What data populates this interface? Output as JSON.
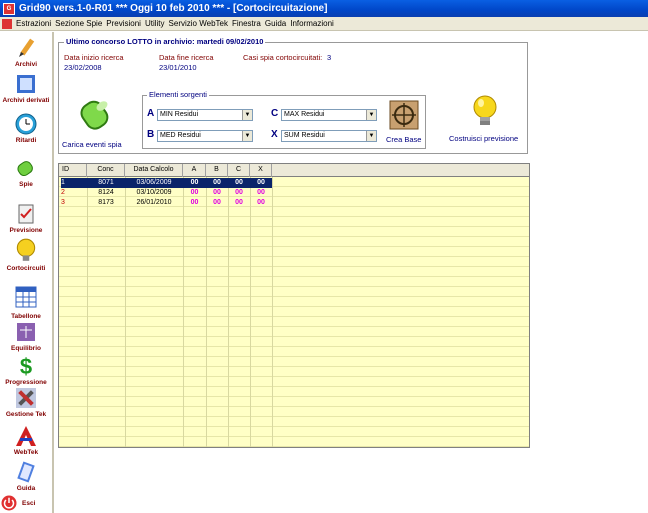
{
  "window": {
    "title": "Grid90 vers.1-0-R01  ***  Oggi 10 feb 2010  ***   - [Cortocircuitazione]"
  },
  "menu": [
    "Estrazioni",
    "Sezione Spie",
    "Previsioni",
    "Utility",
    "Servizio WebTek",
    "Finestra",
    "Guida",
    "Informazioni"
  ],
  "sidebar": [
    {
      "label": "Archivi",
      "icon": "pencil-icon"
    },
    {
      "label": "Archivi derivati",
      "icon": "notebook-icon"
    },
    {
      "label": "Ritardi",
      "icon": "clock-icon"
    },
    {
      "label": "Spie",
      "icon": "lamp-icon"
    },
    {
      "label": "Previsione",
      "icon": "clipboard-icon"
    },
    {
      "label": "Cortocircuiti",
      "icon": "bulb-icon"
    },
    {
      "label": "Tabellone",
      "icon": "calendar-icon"
    },
    {
      "label": "Equilibrio",
      "icon": "scale-icon"
    },
    {
      "label": "Progressione",
      "icon": "dollar-icon"
    },
    {
      "label": "Gestione Tek",
      "icon": "tools-icon"
    },
    {
      "label": "WebTek",
      "icon": "webtek-logo-icon"
    },
    {
      "label": "Guida",
      "icon": "guide-icon"
    },
    {
      "label": "Esci",
      "icon": "exit-icon"
    }
  ],
  "header": {
    "legend": "Ultimo concorso LOTTO in archivio: martedi 09/02/2010",
    "data_inizio_label": "Data inizio ricerca",
    "data_inizio_value": "23/02/2008",
    "data_fine_label": "Data fine ricerca",
    "data_fine_value": "23/01/2010",
    "casi_label": "Casi spia cortocircuitati:",
    "casi_value": "3"
  },
  "actions": {
    "carica": "Carica eventi spia",
    "crea": "Crea Base",
    "costruisci": "Costruisci previsione"
  },
  "elementi": {
    "legend": "Elementi sorgenti",
    "A": {
      "letter": "A",
      "value": "MIN Residui"
    },
    "B": {
      "letter": "B",
      "value": "MED Residui"
    },
    "C": {
      "letter": "C",
      "value": "MAX Residui"
    },
    "X": {
      "letter": "X",
      "value": "SUM Residui"
    }
  },
  "grid": {
    "columns": [
      "ID",
      "Conc",
      "Data Calcolo",
      "A",
      "B",
      "C",
      "X"
    ],
    "rows": [
      {
        "id": "1",
        "conc": "8071",
        "data": "03/06/2009",
        "a": "00",
        "b": "00",
        "c": "00",
        "x": "00",
        "selected": true
      },
      {
        "id": "2",
        "conc": "8124",
        "data": "03/10/2009",
        "a": "00",
        "b": "00",
        "c": "00",
        "x": "00",
        "selected": false
      },
      {
        "id": "3",
        "conc": "8173",
        "data": "26/01/2010",
        "a": "00",
        "b": "00",
        "c": "00",
        "x": "00",
        "selected": false
      }
    ]
  },
  "colors": {
    "title_blue": "#0046c8",
    "grid_bg": "#ffffc6",
    "selected_row": "#0a246a",
    "magenta": "#e000e0",
    "label_red": "#800000",
    "value_blue": "#000080"
  }
}
